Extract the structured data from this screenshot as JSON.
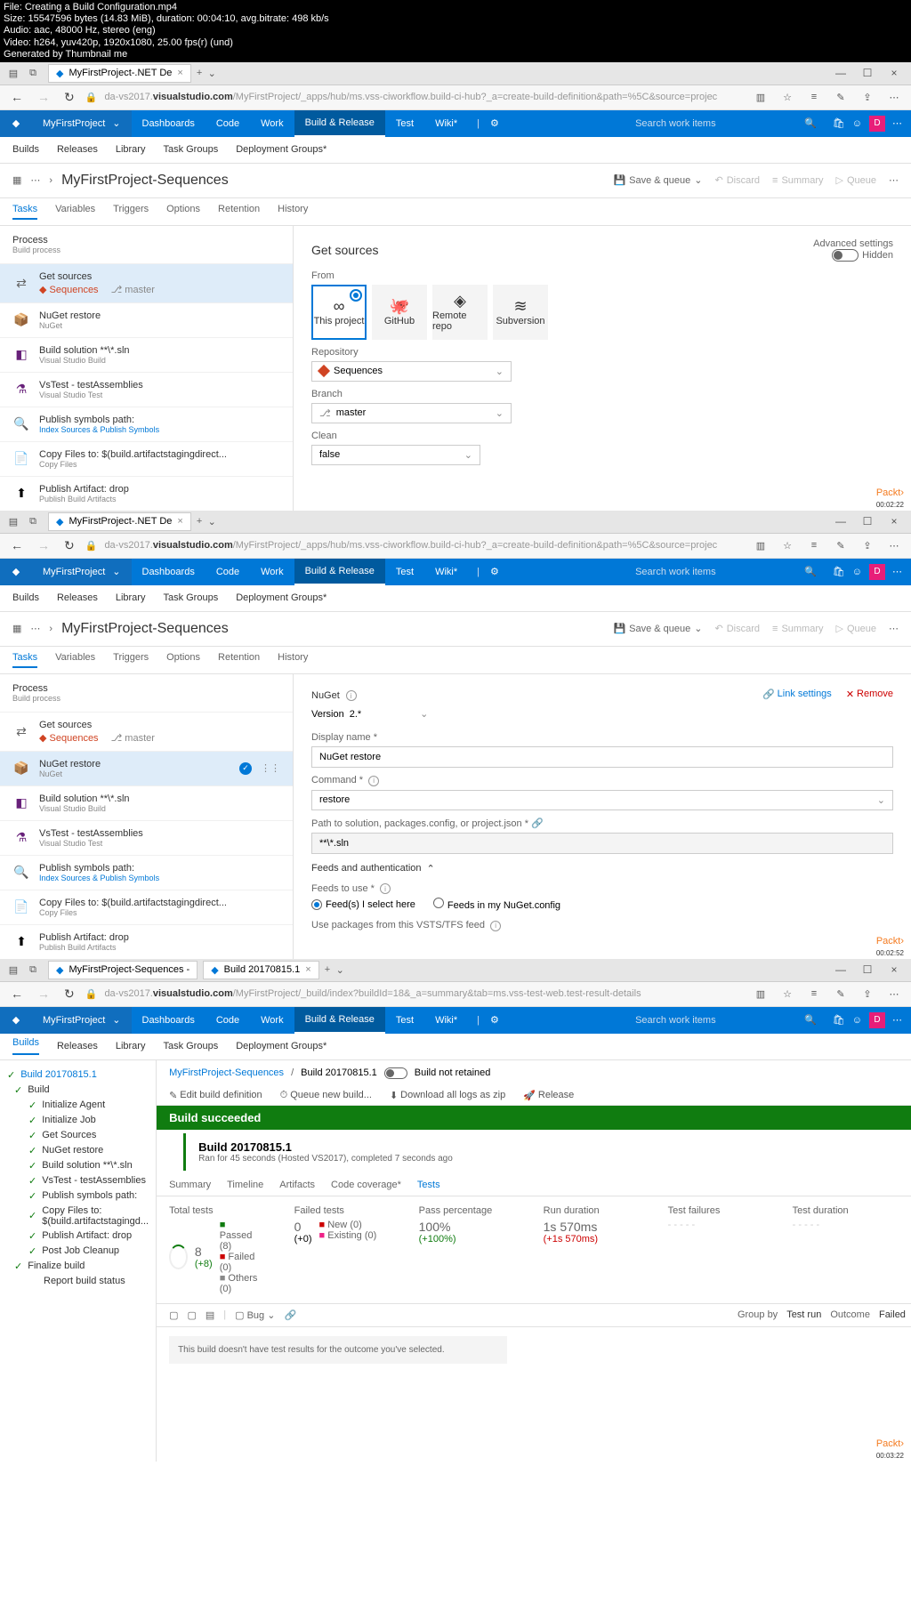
{
  "file_header": {
    "l1": "File: Creating a Build Configuration.mp4",
    "l2": "Size: 15547596 bytes (14.83 MiB), duration: 00:04:10, avg.bitrate: 498 kb/s",
    "l3": "Audio: aac, 48000 Hz, stereo (eng)",
    "l4": "Video: h264, yuv420p, 1920x1080, 25.00 fps(r) (und)",
    "l5": "Generated by Thumbnail me"
  },
  "browser": {
    "tab1": "MyFirstProject-.NET De",
    "tab2": "MyFirstProject-Sequences -",
    "tab3": "Build 20170815.1",
    "url_prefix": "da-vs2017.",
    "url_bold": "visualstudio.com",
    "url_suffix1": "/MyFirstProject/_apps/hub/ms.vss-ciworkflow.build-ci-hub?_a=create-build-definition&path=%5C&source=projec",
    "url_suffix3": "/MyFirstProject/_build/index?buildId=18&_a=summary&tab=ms.vss-test-web.test-result-details"
  },
  "vsts": {
    "project": "MyFirstProject",
    "menu": {
      "dashboards": "Dashboards",
      "code": "Code",
      "work": "Work",
      "build": "Build & Release",
      "test": "Test",
      "wiki": "Wiki*"
    },
    "search_ph": "Search work items",
    "avatar": "D"
  },
  "subnav": {
    "builds": "Builds",
    "releases": "Releases",
    "library": "Library",
    "taskgroups": "Task Groups",
    "depgroups": "Deployment Groups*"
  },
  "page": {
    "title": "MyFirstProject-Sequences",
    "save_queue": "Save & queue",
    "discard": "Discard",
    "summary": "Summary",
    "queue": "Queue"
  },
  "tabs": {
    "tasks": "Tasks",
    "variables": "Variables",
    "triggers": "Triggers",
    "options": "Options",
    "retention": "Retention",
    "history": "History"
  },
  "process": {
    "title": "Process",
    "sub": "Build process"
  },
  "tasks_list": {
    "get_sources": {
      "title": "Get sources",
      "sub1": "Sequences",
      "sub2": "master"
    },
    "nuget": {
      "title": "NuGet restore",
      "sub": "NuGet"
    },
    "build_sln": {
      "title": "Build solution **\\*.sln",
      "sub": "Visual Studio Build"
    },
    "vstest": {
      "title": "VsTest - testAssemblies",
      "sub": "Visual Studio Test"
    },
    "symbols": {
      "title": "Publish symbols path:",
      "sub": "Index Sources & Publish Symbols"
    },
    "copy": {
      "title": "Copy Files to: $(build.artifactstagingdirect...",
      "sub": "Copy Files"
    },
    "artifact": {
      "title": "Publish Artifact: drop",
      "sub": "Publish Build Artifacts"
    }
  },
  "getsources": {
    "title": "Get sources",
    "advanced": "Advanced settings",
    "hidden": "Hidden",
    "from": "From",
    "tiles": {
      "thisproj": "This project",
      "github": "GitHub",
      "remote": "Remote repo",
      "svn": "Subversion"
    },
    "repo_label": "Repository",
    "repo_value": "Sequences",
    "branch_label": "Branch",
    "branch_value": "master",
    "clean_label": "Clean",
    "clean_value": "false"
  },
  "nuget_panel": {
    "title": "NuGet",
    "link": "Link settings",
    "remove": "Remove",
    "version_label": "Version",
    "version_value": "2.*",
    "display_label": "Display name *",
    "display_value": "NuGet restore",
    "command_label": "Command *",
    "command_value": "restore",
    "path_label": "Path to solution, packages.config, or project.json *",
    "path_value": "**\\*.sln",
    "feeds_hdr": "Feeds and authentication",
    "feeds_label": "Feeds to use *",
    "radio1": "Feed(s) I select here",
    "radio2": "Feeds in my NuGet.config",
    "use_pkg": "Use packages from this VSTS/TFS feed"
  },
  "build_result": {
    "crumb1": "MyFirstProject-Sequences",
    "crumb2": "Build 20170815.1",
    "not_retained": "Build not retained",
    "edit": "Edit build definition",
    "queue_new": "Queue new build...",
    "download": "Download all logs as zip",
    "release": "Release",
    "success": "Build succeeded",
    "build_title": "Build 20170815.1",
    "ran_for": "Ran for 45 seconds (Hosted VS2017), completed 7 seconds ago",
    "tabs": {
      "summary": "Summary",
      "timeline": "Timeline",
      "artifacts": "Artifacts",
      "cc": "Code coverage*",
      "tests": "Tests"
    },
    "build_num": "Build 20170815.1",
    "tree": {
      "build": "Build",
      "init_agent": "Initialize Agent",
      "init_job": "Initialize Job",
      "get_sources": "Get Sources",
      "nuget": "NuGet restore",
      "build_sln": "Build solution **\\*.sln",
      "vstest": "VsTest - testAssemblies",
      "symbols": "Publish symbols path:",
      "copy": "Copy Files to: $(build.artifactstagingd...",
      "artifact": "Publish Artifact: drop",
      "cleanup": "Post Job Cleanup",
      "finalize": "Finalize build",
      "report": "Report build status"
    },
    "stats": {
      "total_label": "Total tests",
      "total": "8",
      "total_delta": "(+8)",
      "passed": "Passed",
      "passed_n": "(8)",
      "failed": "Failed",
      "failed_n": "(0)",
      "others": "Others",
      "others_n": "(0)",
      "failed_label": "Failed tests",
      "failed_big": "0",
      "failed_delta": "(+0)",
      "new_l": "New",
      "new_n": "(0)",
      "existing": "Existing",
      "existing_n": "(0)",
      "pass_pct_label": "Pass percentage",
      "pass_pct": "100%",
      "pass_delta": "(+100%)",
      "dur_label": "Run duration",
      "dur": "1s 570ms",
      "dur_delta": "(+1s 570ms)",
      "tf_label": "Test failures",
      "td_label": "Test duration"
    },
    "filter": {
      "groupby": "Group by",
      "testrun": "Test run",
      "outcome": "Outcome",
      "failed": "Failed",
      "bug": "Bug"
    },
    "no_results": "This build doesn't have test results for the outcome you've selected."
  },
  "timestamps": {
    "t1": "00:02:22",
    "t2": "00:02:52",
    "t3": "00:03:22"
  },
  "packt": "Packt›"
}
